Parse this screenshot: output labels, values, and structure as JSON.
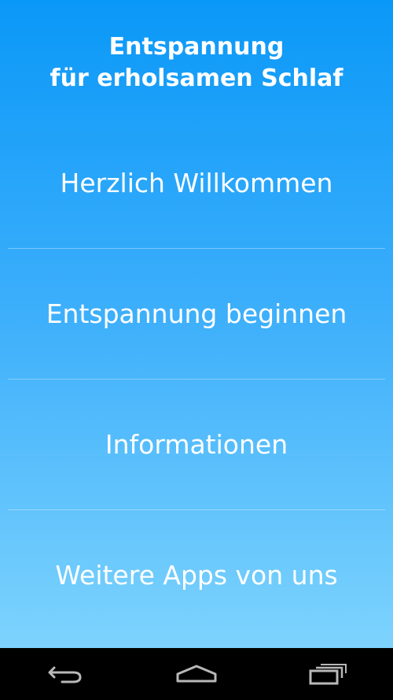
{
  "header": {
    "title_line1": "Entspannung",
    "title_line2": "für erholsamen Schlaf"
  },
  "menu": {
    "items": [
      {
        "label": "Herzlich Willkommen"
      },
      {
        "label": "Entspannung beginnen"
      },
      {
        "label": "Informationen"
      },
      {
        "label": "Weitere Apps von uns"
      }
    ]
  },
  "navbar": {
    "buttons": [
      "back-icon",
      "home-icon",
      "recent-apps-icon"
    ]
  },
  "colors": {
    "gradient_top": "#0a98f8",
    "gradient_bottom": "#7dd3fd",
    "text": "#ffffff",
    "navbar": "#000000"
  }
}
